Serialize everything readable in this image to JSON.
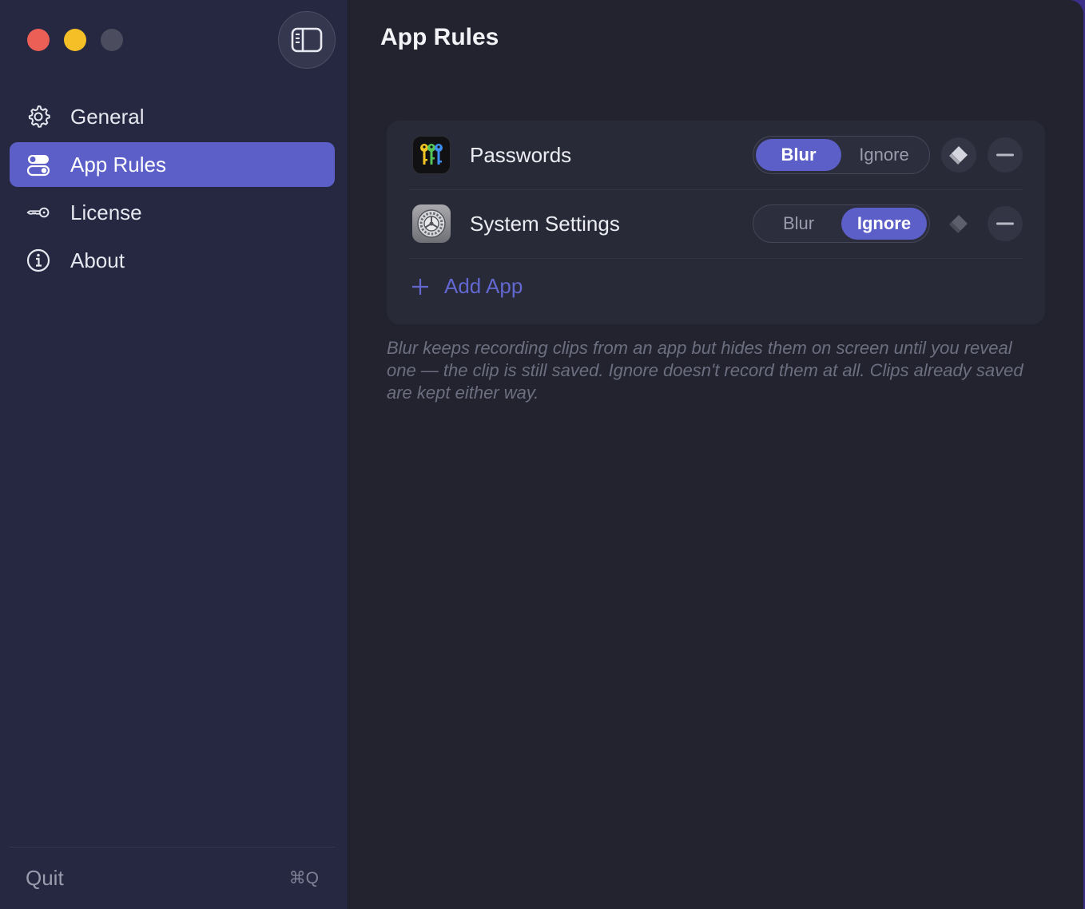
{
  "window": {
    "traffic_lights": [
      "close",
      "minimize",
      "zoom"
    ]
  },
  "sidebar": {
    "toggle_icon": "sidebar-toggle-icon",
    "items": [
      {
        "label": "General",
        "icon": "gear-icon",
        "active": false
      },
      {
        "label": "App Rules",
        "icon": "toggles-icon",
        "active": true
      },
      {
        "label": "License",
        "icon": "key-icon",
        "active": false
      },
      {
        "label": "About",
        "icon": "info-icon",
        "active": false
      }
    ],
    "quit_label": "Quit",
    "quit_shortcut": "⌘Q"
  },
  "main": {
    "title": "App Rules",
    "apps": [
      {
        "name": "Passwords",
        "icon": "passwords-app-icon",
        "mode_options": [
          "Blur",
          "Ignore"
        ],
        "selected": "Blur"
      },
      {
        "name": "System Settings",
        "icon": "system-settings-app-icon",
        "mode_options": [
          "Blur",
          "Ignore"
        ],
        "selected": "Ignore"
      }
    ],
    "add_app_label": "Add App",
    "help_text": "Blur keeps recording clips from an app but hides them on screen until you reveal one — the clip is still saved. Ignore doesn't record them at all. Clips already saved are kept either way."
  },
  "colors": {
    "accent": "#5b5fc7",
    "close": "#ec5f57",
    "minimize": "#f5c027"
  }
}
